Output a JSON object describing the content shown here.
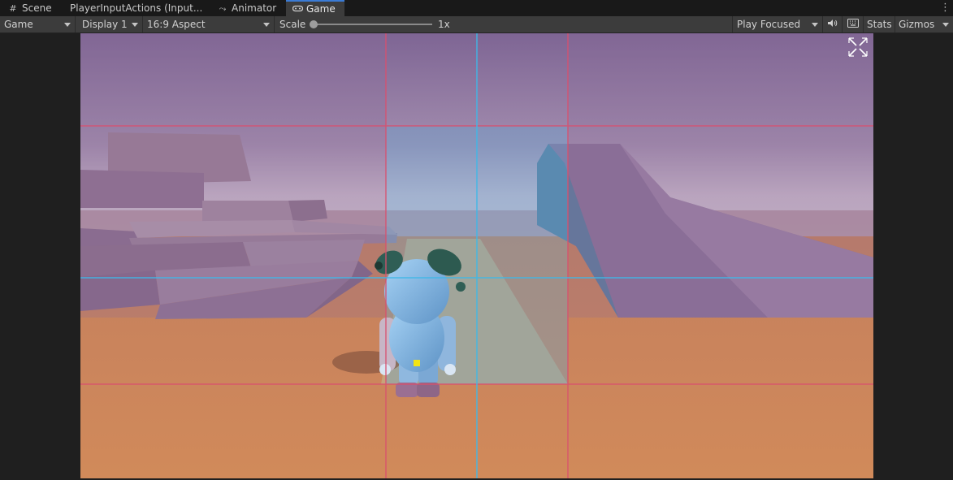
{
  "tabs": [
    {
      "label": "Scene",
      "icon": "grid-icon"
    },
    {
      "label": "PlayerInputActions (Input...",
      "icon": ""
    },
    {
      "label": "Animator",
      "icon": "animator-icon"
    },
    {
      "label": "Game",
      "icon": "gamepad-icon",
      "active": true
    }
  ],
  "toolbar": {
    "view_select": "Game",
    "display_select": "Display 1",
    "aspect_select": "16:9 Aspect",
    "scale_label": "Scale",
    "scale_value": "1x",
    "play_mode_select": "Play Focused",
    "stats_label": "Stats",
    "gizmos_label": "Gizmos"
  },
  "colors": {
    "accent": "#3a7bd5",
    "sky_top": "#7d6494",
    "sky_horizon": "#c8b5cc",
    "ground": "#c98a62",
    "grid_red": "#d9506e",
    "grid_blue": "#3fb8e8",
    "robot": "#7fb7e6"
  }
}
